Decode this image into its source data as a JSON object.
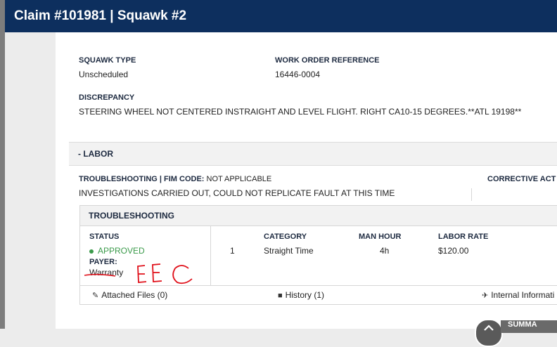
{
  "header": {
    "title": "Claim #101981 | Squawk #2"
  },
  "squawk": {
    "type_label": "SQUAWK TYPE",
    "type_value": "Unscheduled",
    "work_order_label": "WORK ORDER REFERENCE",
    "work_order_value": "16446-0004",
    "discrepancy_label": "DISCREPANCY",
    "discrepancy_value": "STEERING WHEEL NOT CENTERED INSTRAIGHT AND LEVEL FLIGHT. RIGHT CA10-15 DEGREES.**ATL 19198**"
  },
  "labor": {
    "section_label": "- LABOR",
    "troubleshooting_label": "TROUBLESHOOTING | FIM CODE:",
    "fim_code_value": "NOT APPLICABLE",
    "corrective_label": "CORRECTIVE ACT",
    "investigation_text": "INVESTIGATIONS CARRIED OUT, COULD NOT REPLICATE FAULT AT THIS TIME"
  },
  "troubleshooting": {
    "title": "TROUBLESHOOTING",
    "status_label": "STATUS",
    "status_value": "APPROVED",
    "payer_label": "PAYER:",
    "payer_value": "Warranty",
    "handwritten_note": "EEC",
    "columns": {
      "category": "CATEGORY",
      "man_hour": "MAN HOUR",
      "labor_rate": "LABOR RATE"
    },
    "row": {
      "index": "1",
      "category": "Straight Time",
      "man_hour": "4h",
      "labor_rate": "$120.00"
    }
  },
  "footer_links": {
    "attached": "Attached Files (0)",
    "history": "History (1)",
    "internal": "Internal Informati"
  },
  "fab": {
    "label": "SUMMA"
  },
  "colors": {
    "header_bg": "#0d2f5e",
    "approved": "#3a9a4a",
    "annotation": "#e0101a"
  },
  "icons": [
    "paperclip-icon",
    "book-icon",
    "plane-icon",
    "chevron-up-icon"
  ]
}
